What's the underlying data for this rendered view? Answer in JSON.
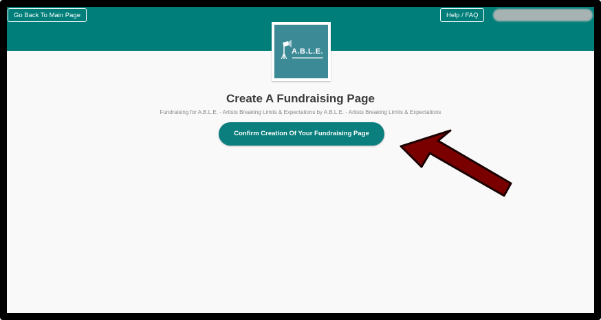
{
  "header": {
    "main_page_button": "Go Back To Main Page",
    "help_button": "Help / FAQ"
  },
  "logo": {
    "text": "A.B.L.E."
  },
  "main": {
    "title": "Create A Fundraising Page",
    "subtitle": "Fundraising for A.B.L.E. - Artists Breaking Limits & Expectations by A.B.L.E. - Artists Breaking Limits & Expectations",
    "confirm_button": "Confirm Creation Of Your Fundraising Page"
  },
  "colors": {
    "header_bg": "#007f7a",
    "button_bg": "#0a7f7d",
    "arrow": "#7a0000",
    "logo_bg": "#3d8a97"
  }
}
